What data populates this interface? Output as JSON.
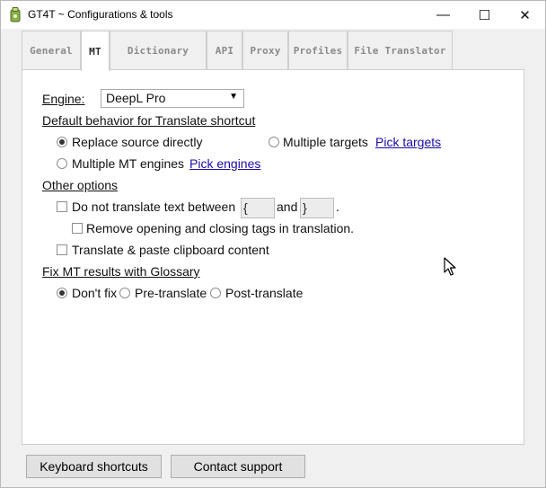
{
  "window": {
    "title": "GT4T ~ Configurations & tools",
    "minimize_glyph": "—",
    "maximize_glyph": "☐",
    "close_glyph": "✕"
  },
  "tabs": [
    {
      "label": "General",
      "active": false
    },
    {
      "label": "MT",
      "active": true
    },
    {
      "label": "Dictionary",
      "active": false
    },
    {
      "label": "API",
      "active": false
    },
    {
      "label": "Proxy",
      "active": false
    },
    {
      "label": "Profiles",
      "active": false
    },
    {
      "label": "File Translator",
      "active": false
    }
  ],
  "engine": {
    "label": "Engine:",
    "selected": "DeepL Pro"
  },
  "default_behavior": {
    "heading": "Default behavior for Translate shortcut",
    "replace_label": "Replace source directly",
    "multiple_targets_label": "Multiple targets",
    "pick_targets_link": "Pick targets",
    "multiple_engines_label": "Multiple MT engines",
    "pick_engines_link": "Pick engines",
    "selected": "replace"
  },
  "other_options": {
    "heading": "Other options",
    "no_translate_label": "Do not translate text between",
    "open_tag": "{",
    "and_label": "and",
    "close_tag": "}",
    "period": ".",
    "remove_tags_label": "Remove opening and closing tags in translation.",
    "clipboard_label": "Translate & paste clipboard content"
  },
  "glossary": {
    "heading": "Fix MT results with Glossary",
    "dont_fix_label": "Don't fix",
    "pre_label": "Pre-translate",
    "post_label": "Post-translate",
    "selected": "dont_fix"
  },
  "footer": {
    "keyboard_shortcuts": "Keyboard shortcuts",
    "contact_support": "Contact support"
  }
}
